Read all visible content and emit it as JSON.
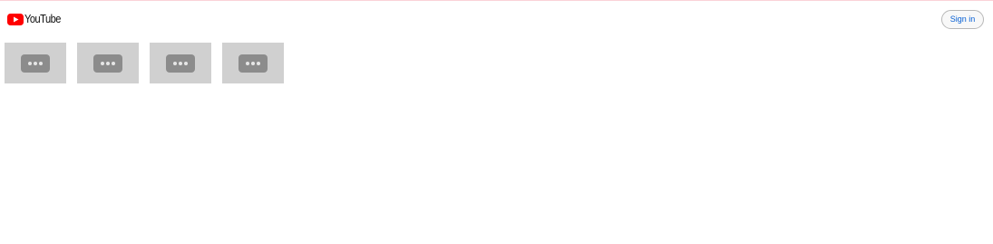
{
  "header": {
    "logo_text": "YouTube",
    "signin_label": "Sign in"
  },
  "thumbnails": [
    {
      "icon": "more-horiz-icon"
    },
    {
      "icon": "more-horiz-icon"
    },
    {
      "icon": "more-horiz-icon"
    },
    {
      "icon": "more-horiz-icon"
    }
  ],
  "colors": {
    "brand_red": "#ff0000",
    "signin_text": "#065fd4",
    "thumb_bg": "#d0d0d0",
    "pill_bg": "#8c8c8c"
  }
}
